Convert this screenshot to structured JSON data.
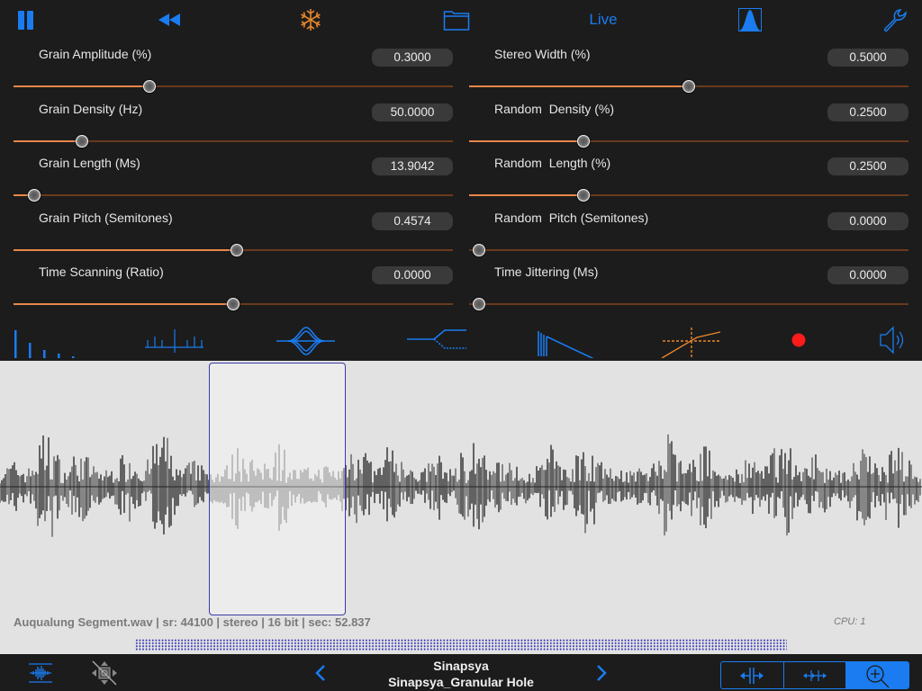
{
  "toolbar": {
    "icons": [
      "pause-icon",
      "rewind-icon",
      "freeze-snowflake-icon",
      "folder-icon",
      "envelope-shape-icon",
      "wrench-icon"
    ],
    "live_label": "Live"
  },
  "colors": {
    "accent_blue": "#1a7cf0",
    "slider_orange": "#e8864a",
    "record_red": "#ff1a1a",
    "freeze_orange": "#e8862a"
  },
  "left_params": [
    {
      "label": "Grain Amplitude (%)",
      "value": "0.3000",
      "position": 0.31
    },
    {
      "label": "Grain Density (Hz)",
      "value": "50.0000",
      "position": 0.155
    },
    {
      "label": "Grain Length (Ms)",
      "value": "13.9042",
      "position": 0.047
    },
    {
      "label": "Grain Pitch (Semitones)",
      "value": "0.4574",
      "position": 0.508
    },
    {
      "label": "Time Scanning (Ratio)",
      "value": "0.0000",
      "position": 0.5
    }
  ],
  "right_params": [
    {
      "label": "Stereo Width (%)",
      "value": "0.5000",
      "position": 0.5
    },
    {
      "label": "Random  Density (%)",
      "value": "0.2500",
      "position": 0.26
    },
    {
      "label": "Random  Length (%)",
      "value": "0.2500",
      "position": 0.26
    },
    {
      "label": "Random  Pitch (Semitones)",
      "value": "0.0000",
      "position": 0.0
    },
    {
      "label": "Time Jittering (Ms)",
      "value": "0.0000",
      "position": 0.0
    }
  ],
  "module_icons": [
    "grain-amplitude-bars-icon",
    "grain-spectrum-icon",
    "grain-envelope-icon",
    "stereo-split-icon",
    "decay-ramp-icon",
    "compressor-curve-icon",
    "record-icon",
    "speaker-icon"
  ],
  "waveform": {
    "file_info": "Auqualung Segment.wav | sr: 44100 | stereo | 16 bit | sec: 52.837",
    "cpu": "CPU: 1"
  },
  "bottom": {
    "preset_bank": "Sinapsya",
    "preset_name": "Sinapsya_Granular Hole",
    "segments": [
      "stretch-selection-icon",
      "move-selection-icon",
      "zoom-in-icon"
    ]
  }
}
